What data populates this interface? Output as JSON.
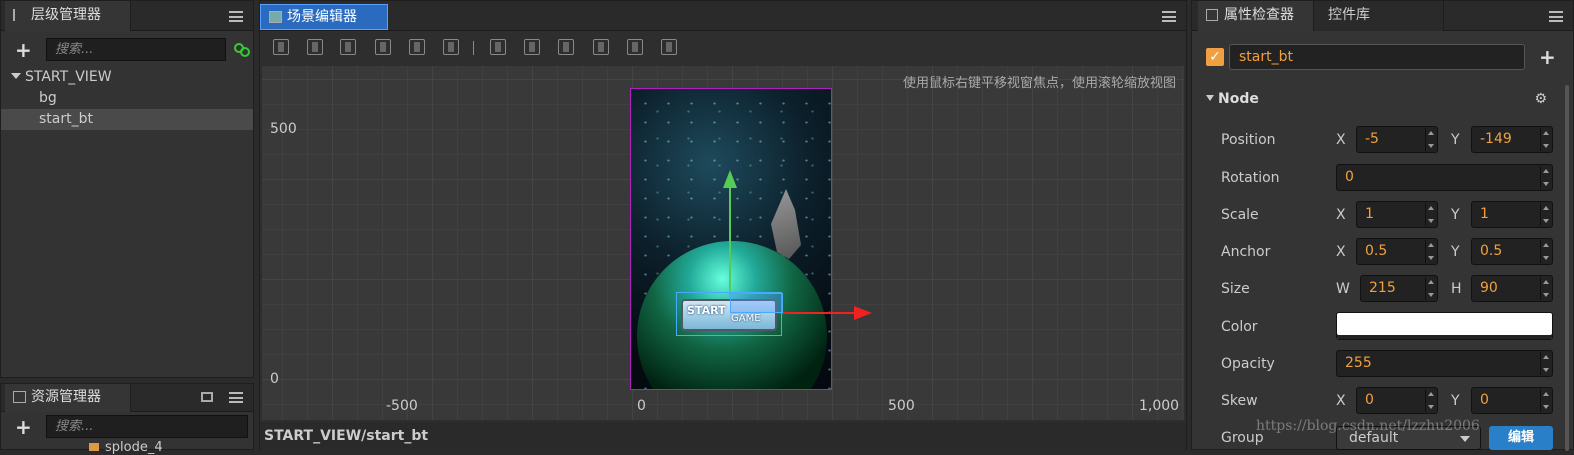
{
  "hierarchy": {
    "tab_label": "层级管理器",
    "search_placeholder": "搜索...",
    "root": "START_VIEW",
    "children": [
      "bg",
      "start_bt"
    ]
  },
  "assets": {
    "tab_label": "资源管理器",
    "search_placeholder": "搜索...",
    "partial_item": "splode_4"
  },
  "scene": {
    "tab_label": "场景编辑器",
    "hint": "使用鼠标右键平移视窗焦点，使用滚轮缩放视图",
    "y_labels": [
      "500",
      "0"
    ],
    "x_labels": [
      "-500",
      "0",
      "500",
      "1,000"
    ],
    "breadcrumb": "START_VIEW/start_bt",
    "button_text_start": "START",
    "button_text_game": "GAME"
  },
  "inspector": {
    "tab_label": "属性检查器",
    "tab2_label": "控件库",
    "node_name": "start_bt",
    "section": "Node",
    "position_label": "Position",
    "position_x": "-5",
    "position_y": "-149",
    "rotation_label": "Rotation",
    "rotation": "0",
    "scale_label": "Scale",
    "scale_x": "1",
    "scale_y": "1",
    "anchor_label": "Anchor",
    "anchor_x": "0.5",
    "anchor_y": "0.5",
    "size_label": "Size",
    "size_w": "215",
    "size_h": "90",
    "color_label": "Color",
    "color_value": "#ffffff",
    "opacity_label": "Opacity",
    "opacity": "255",
    "skew_label": "Skew",
    "skew_x": "0",
    "skew_y": "0",
    "group_label": "Group",
    "group": "default",
    "edit_label": "编辑",
    "x": "X",
    "y": "Y",
    "w": "W",
    "h": "H"
  },
  "watermark": "https://blog.csdn.net/lzzhu2006"
}
